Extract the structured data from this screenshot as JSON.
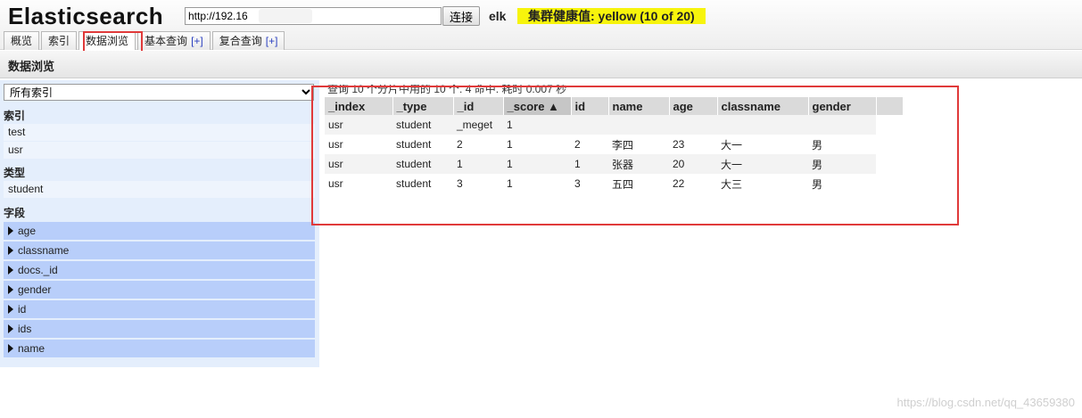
{
  "header": {
    "app_title": "Elasticsearch",
    "url_value": "http://192.16         9200/",
    "connect_label": "连接",
    "cluster_name": "elk",
    "health_text": "集群健康值: yellow (10 of 20)"
  },
  "tabs": [
    {
      "label": "概览",
      "plus": ""
    },
    {
      "label": "索引",
      "plus": ""
    },
    {
      "label": "数据浏览",
      "plus": ""
    },
    {
      "label": "基本查询",
      "plus": "[+]"
    },
    {
      "label": "复合查询",
      "plus": "[+]"
    }
  ],
  "section": {
    "title": "数据浏览"
  },
  "sidebar": {
    "index_select": "所有索引",
    "indices_heading": "索引",
    "indices": [
      "test",
      "usr"
    ],
    "types_heading": "类型",
    "types": [
      "student"
    ],
    "fields_heading": "字段",
    "fields": [
      "age",
      "classname",
      "docs._id",
      "gender",
      "id",
      "ids",
      "name"
    ]
  },
  "results": {
    "summary": "查询 10 个分片中用的 10 个. 4 命中. 耗时 0.007 秒",
    "columns": [
      "_index",
      "_type",
      "_id",
      "_score ▲",
      "id",
      "name",
      "age",
      "classname",
      "gender"
    ],
    "rows": [
      [
        "usr",
        "student",
        "_meget",
        "1",
        "",
        "",
        "",
        "",
        ""
      ],
      [
        "usr",
        "student",
        "2",
        "1",
        "2",
        "李四",
        "23",
        "大一",
        "男"
      ],
      [
        "usr",
        "student",
        "1",
        "1",
        "1",
        "张器",
        "20",
        "大一",
        "男"
      ],
      [
        "usr",
        "student",
        "3",
        "1",
        "3",
        "五四",
        "22",
        "大三",
        "男"
      ]
    ]
  },
  "watermark": "https://blog.csdn.net/qq_43659380",
  "colors": {
    "health": "#f7f40c",
    "highlight": "#e03a3a",
    "sidebar": "#e4eefc",
    "field": "#b8cefa"
  }
}
